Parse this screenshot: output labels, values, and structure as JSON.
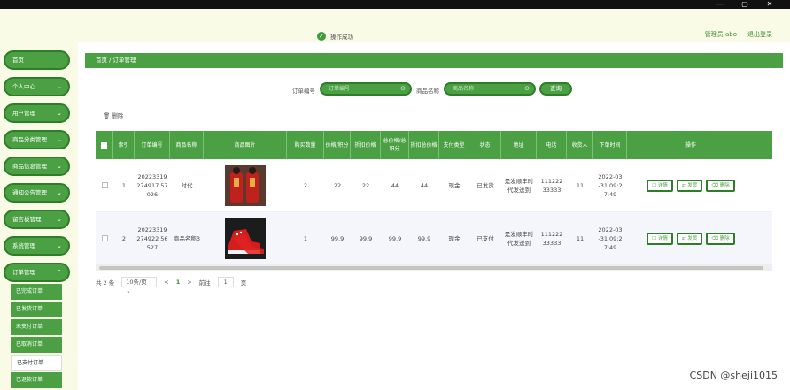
{
  "window": {
    "minimize": "—",
    "maximize": "▢",
    "close": "✕"
  },
  "toast": {
    "text": "操作成功"
  },
  "header": {
    "admin": "管理员 abo",
    "logout": "退出登录"
  },
  "sidebar": {
    "items": [
      {
        "label": "首页",
        "has_chevron": false
      },
      {
        "label": "个人中心",
        "has_chevron": true
      },
      {
        "label": "用户管理",
        "has_chevron": true
      },
      {
        "label": "商品分类管理",
        "has_chevron": true
      },
      {
        "label": "商品信息管理",
        "has_chevron": true
      },
      {
        "label": "通知公告管理",
        "has_chevron": true
      },
      {
        "label": "留言板管理",
        "has_chevron": true
      },
      {
        "label": "系统管理",
        "has_chevron": true
      },
      {
        "label": "订单管理",
        "has_chevron": true
      }
    ],
    "chevron": "⌄",
    "submenu": [
      "已完成订单",
      "已发货订单",
      "未支付订单",
      "已取消订单",
      "已支付订单",
      "已退款订单"
    ],
    "active_submenu": 4
  },
  "breadcrumb": {
    "home": "首页",
    "sep": "/",
    "current": "订单管理"
  },
  "search": {
    "order_label": "订单编号",
    "order_placeholder": "订单编号",
    "product_label": "商品名称",
    "product_placeholder": "商品名称",
    "query_button": "查询"
  },
  "toolbar": {
    "delete_label": "删除"
  },
  "table": {
    "headers": [
      "",
      "索引",
      "订单编号",
      "商品名称",
      "商品图片",
      "购买数量",
      "价格/积分",
      "折扣价格",
      "总价格/总积分",
      "折扣总价格",
      "支付类型",
      "状态",
      "地址",
      "电话",
      "收货人",
      "下单时间",
      "操作"
    ],
    "rows": [
      {
        "index": "1",
        "order_no": "20223319274917 57026",
        "product": "时代",
        "qty": "2",
        "price": "22",
        "discount": "22",
        "total": "44",
        "discount_total": "44",
        "pay_type": "现金",
        "status": "已发货",
        "address": "是发顺丰时代发送到",
        "phone": "11122233333",
        "receiver": "11",
        "time": "2022-03 -31 09:2 7:49"
      },
      {
        "index": "2",
        "order_no": "20223319274922 56527",
        "product": "商品名称3",
        "qty": "1",
        "price": "99.9",
        "discount": "99.9",
        "total": "99.9",
        "discount_total": "99.9",
        "pay_type": "现金",
        "status": "已支付",
        "address": "是发顺丰时代发送到",
        "phone": "11122233333",
        "receiver": "11",
        "time": "2022-03 -31 09:2 7:49"
      }
    ],
    "actions": {
      "detail": "详情",
      "ship": "发货",
      "delete": "删除"
    }
  },
  "pager": {
    "total": "共 2 条",
    "page_size": "10条/页",
    "prev": "<",
    "current_page": "1",
    "next": ">",
    "goto_label": "前往",
    "goto_value": "1",
    "page_unit": "页"
  },
  "watermark": "CSDN @sheji1015"
}
